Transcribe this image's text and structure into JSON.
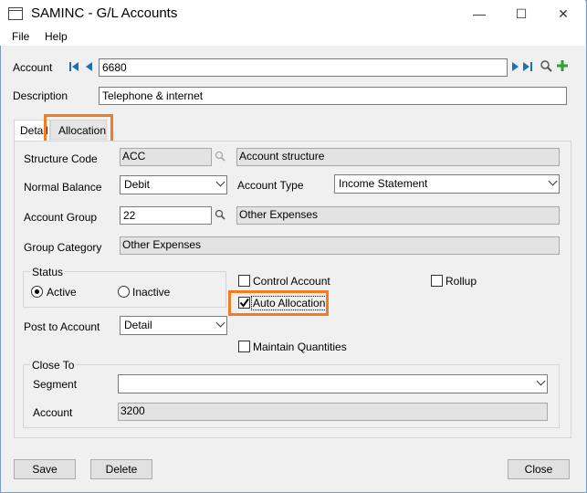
{
  "window": {
    "title": "SAMINC - G/L Accounts",
    "minimize": "—",
    "maximize": "☐",
    "close": "✕"
  },
  "menu": {
    "file": "File",
    "help": "Help"
  },
  "account": {
    "label": "Account",
    "value": "6680",
    "description_label": "Description",
    "description_value": "Telephone & internet"
  },
  "tabs": {
    "detail": "Detail",
    "allocation": "Allocation"
  },
  "detail": {
    "structure_code_label": "Structure Code",
    "structure_code_value": "ACC",
    "structure_desc": "Account structure",
    "normal_balance_label": "Normal Balance",
    "normal_balance_value": "Debit",
    "account_type_label": "Account Type",
    "account_type_value": "Income Statement",
    "account_group_label": "Account Group",
    "account_group_value": "22",
    "account_group_desc": "Other Expenses",
    "group_category_label": "Group Category",
    "group_category_value": "Other Expenses",
    "status_label": "Status",
    "status_active": "Active",
    "status_inactive": "Inactive",
    "control_account": "Control Account",
    "rollup": "Rollup",
    "auto_allocation": "Auto Allocation",
    "maintain_quantities": "Maintain Quantities",
    "post_to_label": "Post to Account",
    "post_to_value": "Detail",
    "close_to_label": "Close To",
    "segment_label": "Segment",
    "segment_value": "",
    "close_account_label": "Account",
    "close_account_value": "3200"
  },
  "buttons": {
    "save": "Save",
    "delete": "Delete",
    "close": "Close"
  },
  "colors": {
    "highlight": "#f47c20",
    "nav_blue": "#1e6fb8",
    "add_green": "#2e9e2e"
  }
}
